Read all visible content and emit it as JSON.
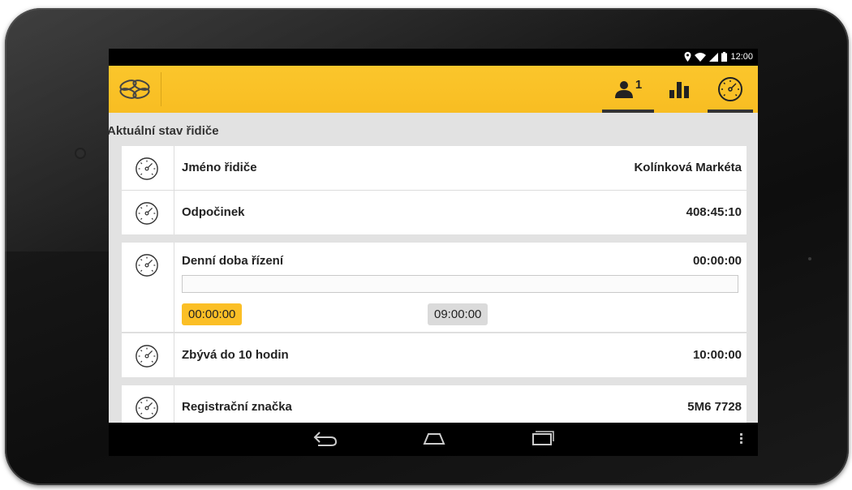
{
  "status_bar": {
    "time": "12:00",
    "icons": [
      "location-icon",
      "wifi-icon",
      "signal-icon",
      "battery-icon"
    ]
  },
  "action_bar": {
    "driver_badge": "1",
    "active_tab": "tachograph",
    "accent": "#f8bd22"
  },
  "section": {
    "title": "Aktuální stav řidiče"
  },
  "rows": [
    {
      "label": "Jméno řidiče",
      "value": "Kolínková Markéta"
    },
    {
      "label": "Odpočinek",
      "value": "408:45:10"
    }
  ],
  "driving": {
    "label": "Denní doba řízení",
    "value": "00:00:00",
    "progress_fraction": 0.0,
    "start_time": "00:00:00",
    "end_time": "09:00:00"
  },
  "rows2": [
    {
      "label": "Zbývá do 10 hodin",
      "value": "10:00:00"
    }
  ],
  "rows3": [
    {
      "label": "Registrační značka",
      "value": "5M6 7728"
    }
  ],
  "nav": [
    "back-icon",
    "home-icon",
    "recent-apps-icon",
    "menu-icon"
  ]
}
